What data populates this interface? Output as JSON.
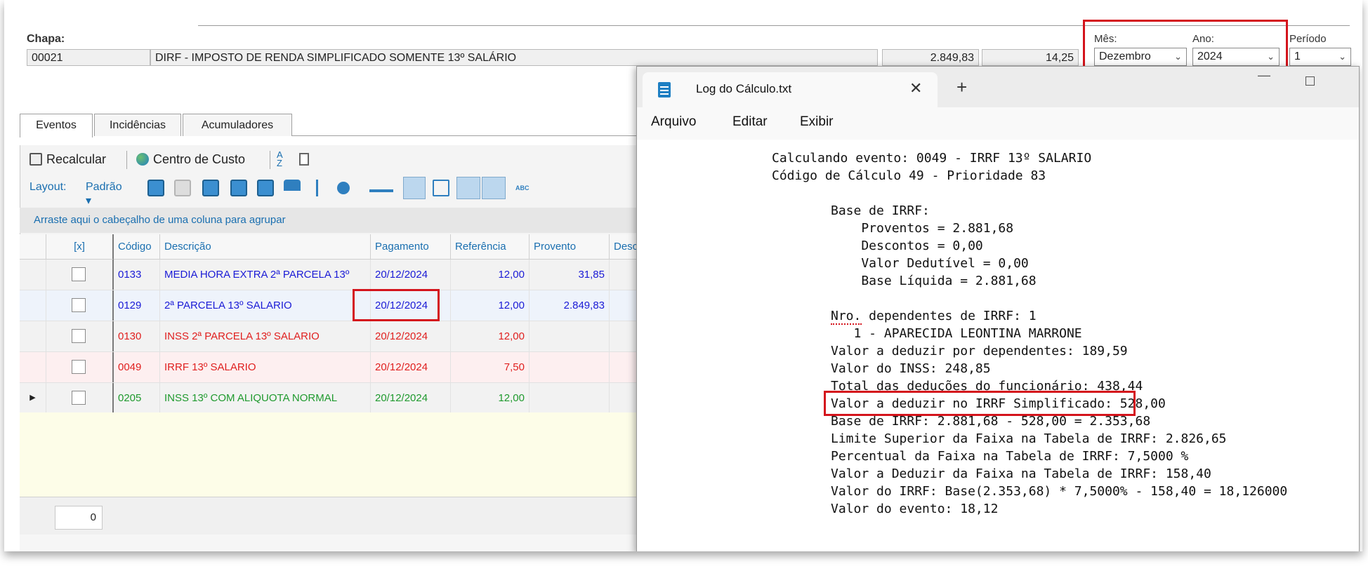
{
  "header": {
    "chapa_label": "Chapa:",
    "chapa_code": "00021",
    "chapa_desc": "DIRF - IMPOSTO DE RENDA SIMPLIFICADO SOMENTE 13º SALÁRIO",
    "value1": "2.849,83",
    "value2": "14,25",
    "mes_label": "Mês:",
    "mes_value": "Dezembro",
    "ano_label": "Ano:",
    "ano_value": "2024",
    "periodo_label": "Período",
    "periodo_value": "1"
  },
  "tabs": [
    "Eventos",
    "Incidências",
    "Acumuladores"
  ],
  "toolbar": {
    "recalcular": "Recalcular",
    "centro_custo": "Centro de Custo",
    "layout_label": "Layout:",
    "padrao": "Padrão"
  },
  "grid": {
    "group_hint": "Arraste aqui o cabeçalho de uma coluna para agrupar",
    "columns": [
      "[x]",
      "Código",
      "Descrição",
      "Pagamento",
      "Referência",
      "Provento",
      "Desco"
    ],
    "rows": [
      {
        "codigo": "0133",
        "descricao": "MEDIA HORA EXTRA 2ª PARCELA 13º",
        "pagamento": "20/12/2024",
        "referencia": "12,00",
        "provento": "31,85",
        "color": "#1b1bd6"
      },
      {
        "codigo": "0129",
        "descricao": "2ª PARCELA 13º SALARIO",
        "pagamento": "20/12/2024",
        "referencia": "12,00",
        "provento": "2.849,83",
        "color": "#1b1bd6"
      },
      {
        "codigo": "0130",
        "descricao": "INSS 2ª PARCELA 13º SALARIO",
        "pagamento": "20/12/2024",
        "referencia": "12,00",
        "provento": "",
        "color": "#e0201f"
      },
      {
        "codigo": "0049",
        "descricao": "IRRF 13º SALARIO",
        "pagamento": "20/12/2024",
        "referencia": "7,50",
        "provento": "",
        "color": "#e0201f"
      },
      {
        "codigo": "0205",
        "descricao": "INSS 13º COM ALIQUOTA NORMAL",
        "pagamento": "20/12/2024",
        "referencia": "12,00",
        "provento": "",
        "color": "#1f9a2e"
      }
    ],
    "footer_count": "0"
  },
  "notepad": {
    "tab_title": "Log do Cálculo.txt",
    "menu": [
      "Arquivo",
      "Editar",
      "Exibir"
    ],
    "lines": [
      "Calculando evento: 0049 - IRRF 13º SALARIO",
      "Código de Cálculo 49 - Prioridade 83",
      "",
      "Base de IRRF:",
      "    Proventos = 2.881,68",
      "    Descontos = 0,00",
      "    Valor Dedutível = 0,00",
      "    Base Líquida = 2.881,68",
      "",
      "Nro. dependentes de IRRF: 1",
      "   1 - APARECIDA LEONTINA MARRONE",
      "Valor a deduzir por dependentes: 189,59",
      "Valor do INSS: 248,85",
      "Total das deduções do funcionário: 438,44",
      "Valor a deduzir no IRRF Simplificado: 528,00",
      "Base de IRRF: 2.881,68 - 528,00 = 2.353,68",
      "Limite Superior da Faixa na Tabela de IRRF: 2.826,65",
      "Percentual da Faixa na Tabela de IRRF: 7,5000 %",
      "Valor a Deduzir da Faixa na Tabela de IRRF: 158,40",
      "Valor do IRRF: Base(2.353,68) * 7,5000% - 158,40 = 18,126000",
      "Valor do evento: 18,12"
    ]
  },
  "colors": {
    "highlight_red": "#d4141c",
    "link_blue": "#1a6fb0"
  }
}
